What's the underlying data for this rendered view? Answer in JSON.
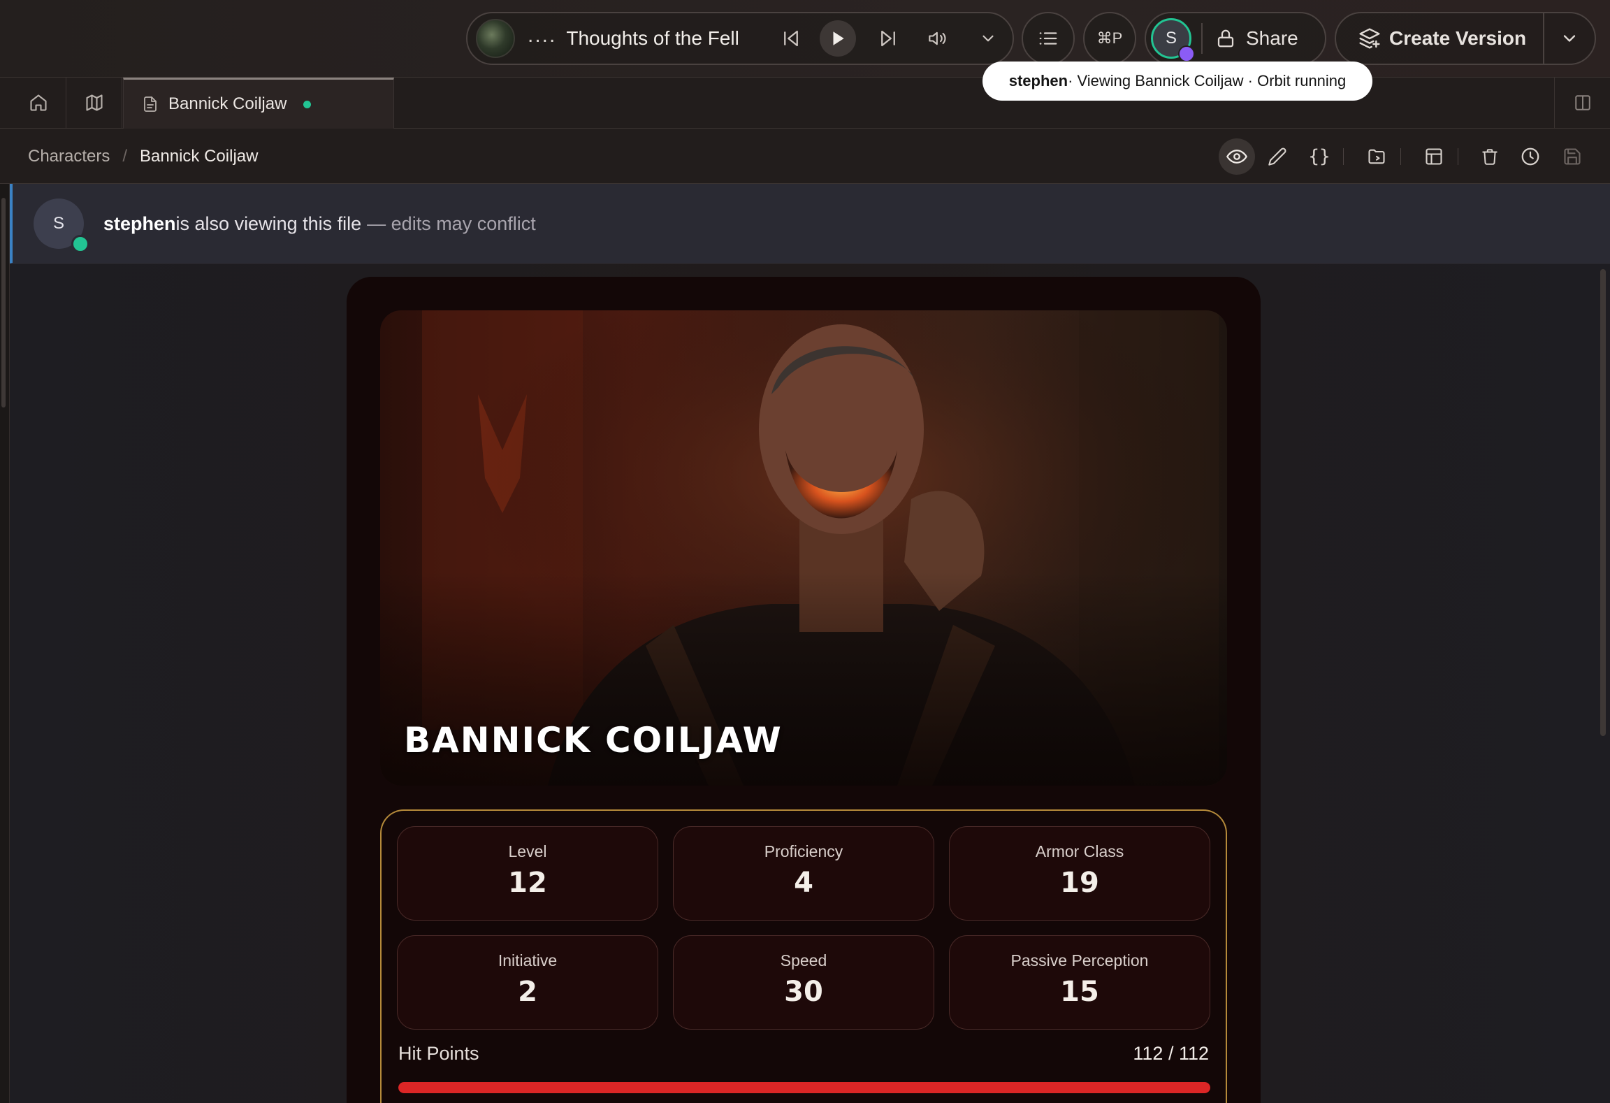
{
  "player": {
    "dots": "....",
    "track_title": "Thoughts of the Fell"
  },
  "topbar": {
    "command_palette_label": "⌘P",
    "user_initial": "S",
    "share_label": "Share",
    "create_version_label": "Create Version"
  },
  "tooltip": {
    "user": "stephen",
    "text": " · Viewing Bannick Coiljaw · Orbit running"
  },
  "tabs": {
    "active_label": "Bannick Coiljaw"
  },
  "breadcrumb": {
    "parent": "Characters",
    "separator": "/",
    "current": "Bannick Coiljaw"
  },
  "banner": {
    "avatar_initial": "S",
    "user": "stephen",
    "message": " is also viewing this file",
    "warning": "— edits may conflict"
  },
  "character": {
    "name": "Bannick Coiljaw",
    "stats": [
      {
        "label": "Level",
        "value": "12"
      },
      {
        "label": "Proficiency",
        "value": "4"
      },
      {
        "label": "Armor Class",
        "value": "19"
      },
      {
        "label": "Initiative",
        "value": "2"
      },
      {
        "label": "Speed",
        "value": "30"
      },
      {
        "label": "Passive Perception",
        "value": "15"
      }
    ],
    "hit_points": {
      "label": "Hit Points",
      "display": "112 / 112",
      "current": 112,
      "max": 112
    }
  },
  "colors": {
    "accent_green": "#22c493",
    "banner_accent": "#3b82c4",
    "hp_bar": "#dc2626",
    "stats_border": "#b58a3a"
  }
}
